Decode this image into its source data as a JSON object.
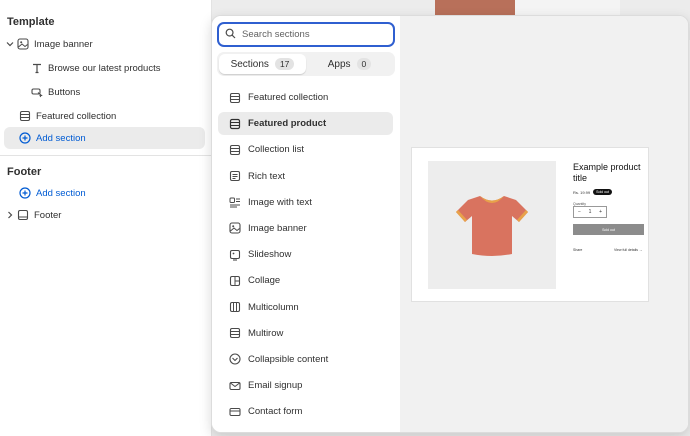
{
  "sidebar": {
    "template_heading": "Template",
    "image_banner": "Image banner",
    "browse_label": "Browse our latest products",
    "buttons_label": "Buttons",
    "featured_collection": "Featured collection",
    "add_section_template": "Add section",
    "footer_heading": "Footer",
    "add_section_footer": "Add section",
    "footer_label": "Footer"
  },
  "popover": {
    "search_placeholder": "Search sections",
    "tabs": [
      {
        "label": "Sections",
        "count": "17",
        "active": true
      },
      {
        "label": "Apps",
        "count": "0",
        "active": false
      }
    ],
    "items": [
      {
        "label": "Featured collection",
        "icon": "featured-collection-icon"
      },
      {
        "label": "Featured product",
        "icon": "featured-product-icon",
        "selected": true
      },
      {
        "label": "Collection list",
        "icon": "collection-list-icon"
      },
      {
        "label": "Rich text",
        "icon": "rich-text-icon"
      },
      {
        "label": "Image with text",
        "icon": "image-with-text-icon"
      },
      {
        "label": "Image banner",
        "icon": "image-banner-icon"
      },
      {
        "label": "Slideshow",
        "icon": "slideshow-icon"
      },
      {
        "label": "Collage",
        "icon": "collage-icon"
      },
      {
        "label": "Multicolumn",
        "icon": "multicolumn-icon"
      },
      {
        "label": "Multirow",
        "icon": "multirow-icon"
      },
      {
        "label": "Collapsible content",
        "icon": "collapsible-content-icon"
      },
      {
        "label": "Email signup",
        "icon": "email-signup-icon"
      },
      {
        "label": "Contact form",
        "icon": "contact-form-icon"
      }
    ]
  },
  "preview": {
    "product_title": "Example product title",
    "price": "Rs. 19.99",
    "sold_out_badge": "Sold out",
    "quantity_label": "Quantity",
    "qty_minus": "−",
    "qty_value": "1",
    "qty_plus": "+",
    "sold_out_button": "Sold out",
    "share": "Share",
    "view_full_details": "View full details →"
  },
  "colors": {
    "accent_blue": "#005bd3",
    "search_focus": "#2f5fd0",
    "tshirt": "#d9735f",
    "tshirt_trim": "#e8a24a"
  }
}
